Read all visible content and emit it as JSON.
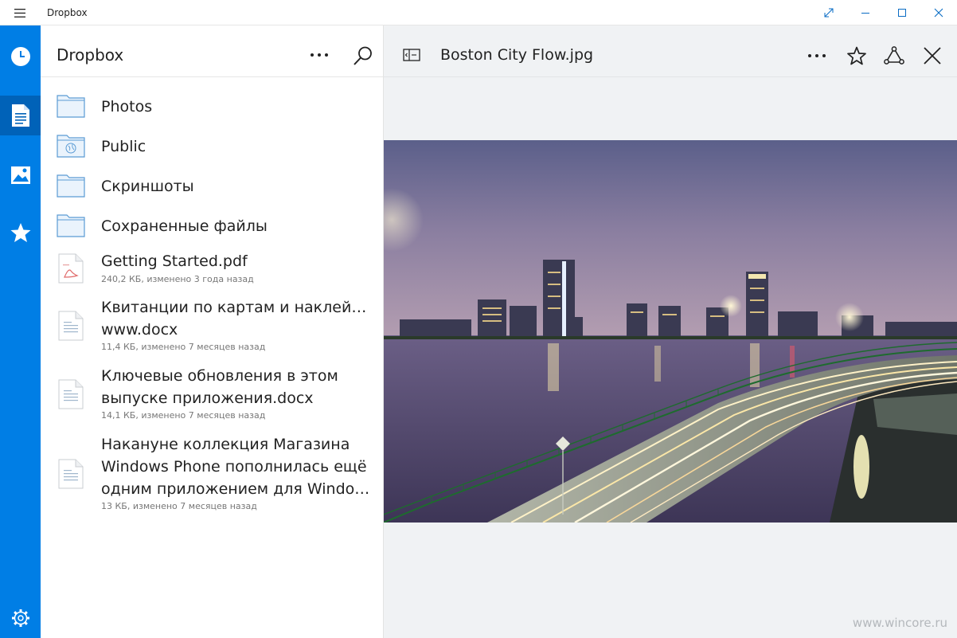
{
  "window": {
    "title": "Dropbox"
  },
  "list": {
    "title": "Dropbox",
    "items": [
      {
        "name": "Photos",
        "type": "folder"
      },
      {
        "name": "Public",
        "type": "folder-public"
      },
      {
        "name": "Скриншоты",
        "type": "folder"
      },
      {
        "name": "Сохраненные файлы",
        "type": "folder"
      },
      {
        "name": "Getting Started.pdf",
        "type": "pdf",
        "meta": "240,2 КБ, изменено 3 года назад"
      },
      {
        "name": "Квитанции по картам и наклейкам www.docx",
        "line1": "Квитанции по картам и наклейкам",
        "line2": "www.docx",
        "type": "doc",
        "meta": "11,4 КБ, изменено 7 месяцев назад"
      },
      {
        "name": "Ключевые обновления в этом выпуске приложения.docx",
        "line1": "Ключевые обновления в этом",
        "line2": "выпуске приложения.docx",
        "type": "doc",
        "meta": "14,1 КБ, изменено 7 месяцев назад"
      },
      {
        "name": "Накануне коллекция Магазина Windows Phone пополнилась ещё одним приложением для Window...",
        "line1": "Накануне коллекция Магазина",
        "line2": "Windows Phone пополнилась ещё",
        "line3": "одним приложением для Window...",
        "type": "doc",
        "meta": "13 КБ, изменено 7 месяцев назад"
      }
    ]
  },
  "viewer": {
    "file_name": "Boston City Flow.jpg"
  },
  "watermark": "www.wincore.ru",
  "colors": {
    "rail": "#007ee5",
    "rail_active": "#0062b8",
    "folder": "#5a9bd4"
  }
}
